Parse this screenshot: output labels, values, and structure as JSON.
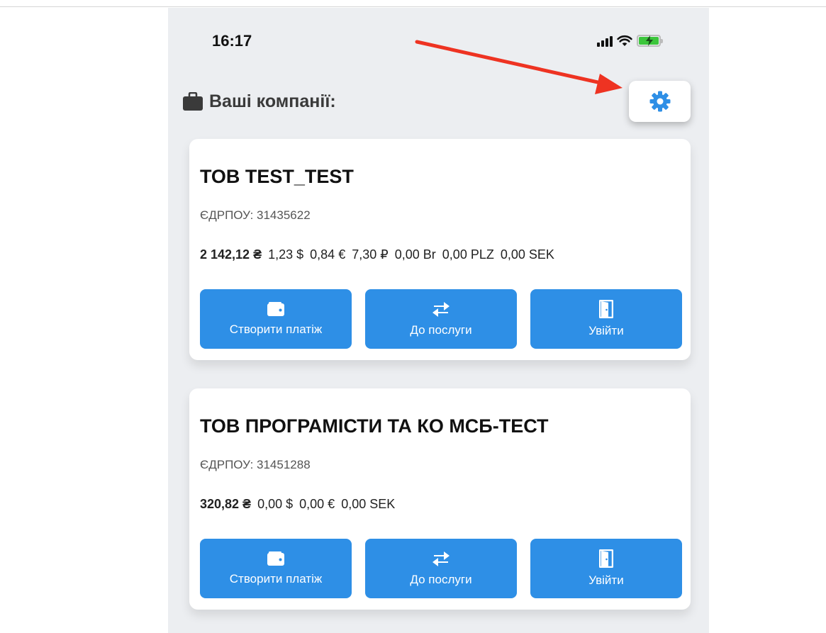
{
  "status_bar": {
    "time": "16:17"
  },
  "header": {
    "title": "Ваші компанії:",
    "icon": "briefcase-icon"
  },
  "settings": {
    "icon": "gear-icon"
  },
  "colors": {
    "accent": "#2e8fe6",
    "background": "#eceef1",
    "annotation_arrow": "#ee3322"
  },
  "companies": [
    {
      "name": "ТОВ TEST_TEST",
      "edrpou": "ЄДРПОУ: 31435622",
      "balances": [
        "2 142,12 ₴",
        "1,23 $",
        "0,84 €",
        "7,30 ₽",
        "0,00 Br",
        "0,00 PLZ",
        "0,00 SEK"
      ],
      "actions": [
        {
          "label": "Створити платіж",
          "icon": "wallet-icon"
        },
        {
          "label": "До послуги",
          "icon": "exchange-icon"
        },
        {
          "label": "Увійти",
          "icon": "door-icon"
        }
      ]
    },
    {
      "name": "ТОВ ПРОГРАМІСТИ ТА КО МСБ-ТЕСТ",
      "edrpou": "ЄДРПОУ: 31451288",
      "balances": [
        "320,82 ₴",
        "0,00 $",
        "0,00 €",
        "0,00 SEK"
      ],
      "actions": [
        {
          "label": "Створити платіж",
          "icon": "wallet-icon"
        },
        {
          "label": "До послуги",
          "icon": "exchange-icon"
        },
        {
          "label": "Увійти",
          "icon": "door-icon"
        }
      ]
    }
  ]
}
